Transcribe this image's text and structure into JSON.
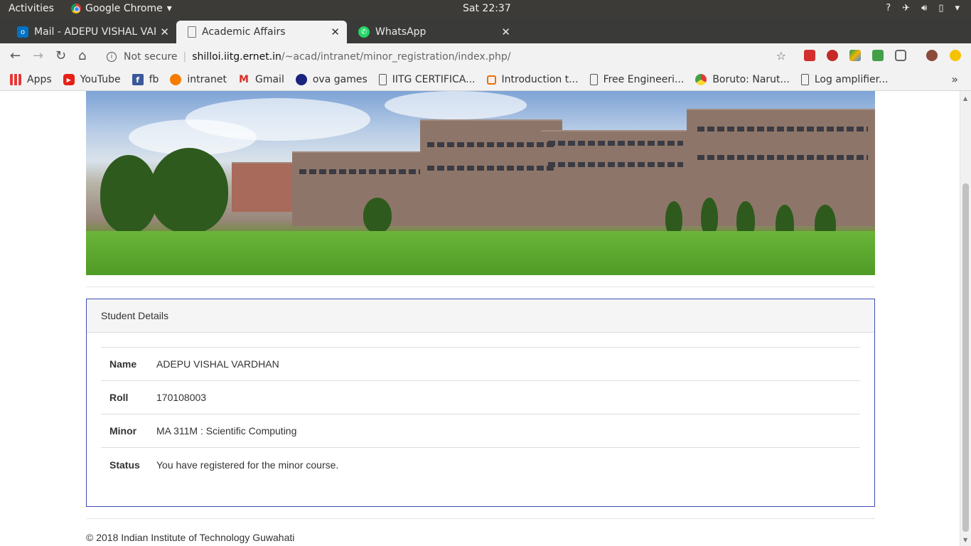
{
  "system_bar": {
    "activities": "Activities",
    "app_name": "Google Chrome",
    "clock": "Sat 22:37"
  },
  "tabs": [
    {
      "label": "Mail - ADEPU VISHAL VAR",
      "icon": "outlook-icon",
      "color": "#0072c6"
    },
    {
      "label": "Academic Affairs",
      "icon": "page-icon",
      "color": "#777777"
    },
    {
      "label": "WhatsApp",
      "icon": "whatsapp-icon",
      "color": "#25d366"
    }
  ],
  "omnibox": {
    "security_label": "Not secure",
    "host": "shilloi.iitg.ernet.in",
    "path": "/~acad/intranet/minor_registration/index.php/"
  },
  "bookmarks": [
    {
      "label": "Apps",
      "icon": "apps-grid-icon"
    },
    {
      "label": "YouTube",
      "icon": "youtube-icon"
    },
    {
      "label": "fb",
      "icon": "facebook-icon"
    },
    {
      "label": "intranet",
      "icon": "intranet-icon"
    },
    {
      "label": "Gmail",
      "icon": "gmail-icon"
    },
    {
      "label": "ova games",
      "icon": "ova-games-icon"
    },
    {
      "label": "IITG CERTIFICA...",
      "icon": "page-icon"
    },
    {
      "label": "Introduction t...",
      "icon": "chip-icon"
    },
    {
      "label": "Free Engineeri...",
      "icon": "page-icon"
    },
    {
      "label": "Boruto: Narut...",
      "icon": "boruto-icon"
    },
    {
      "label": "Log amplifier...",
      "icon": "page-icon"
    }
  ],
  "panel": {
    "heading": "Student Details",
    "rows": [
      {
        "key": "Name",
        "value": "ADEPU VISHAL VARDHAN"
      },
      {
        "key": "Roll",
        "value": "170108003"
      },
      {
        "key": "Minor",
        "value": "MA 311M : Scientific Computing"
      },
      {
        "key": "Status",
        "value": "You have registered for the minor course."
      }
    ]
  },
  "footer": "© 2018  Indian Institute of Technology Guwahati",
  "colors": {
    "panel_border": "#3d4db5",
    "titlebar": "#3c3b37"
  }
}
